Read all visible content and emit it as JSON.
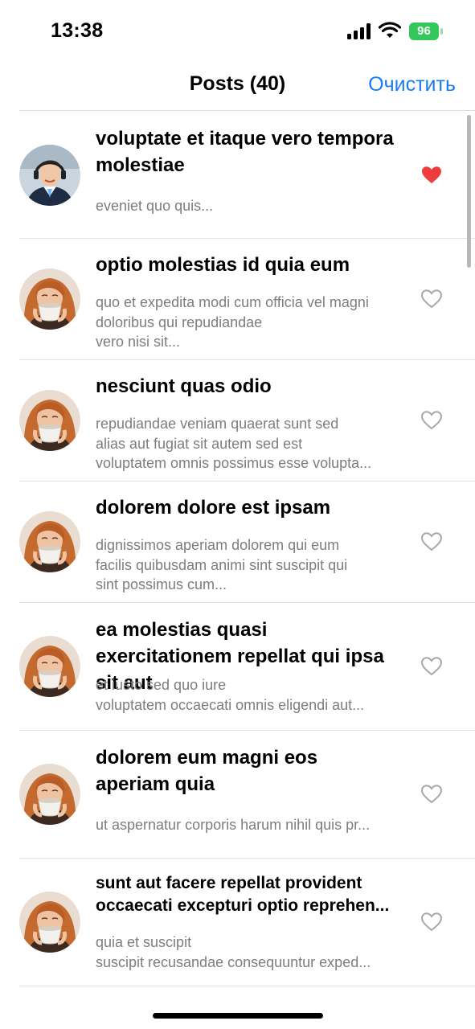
{
  "status_bar": {
    "time": "13:38",
    "battery": "96"
  },
  "nav": {
    "title": "Posts (40)",
    "action": "Очистить"
  },
  "posts": [
    {
      "title": "voluptate et itaque vero tempora molestiae",
      "body": [
        "eveniet quo quis..."
      ],
      "liked": true,
      "avatar": "man-headphones-icon"
    },
    {
      "title": "optio molestias id quia eum",
      "body": [
        "quo et expedita modi cum officia vel magni",
        "doloribus qui repudiandae",
        "vero nisi sit..."
      ],
      "liked": false,
      "avatar": "woman-coffee-icon"
    },
    {
      "title": "nesciunt quas odio",
      "body": [
        "repudiandae veniam quaerat sunt sed",
        "alias aut fugiat sit autem sed est",
        "voluptatem omnis possimus esse volupta..."
      ],
      "liked": false,
      "avatar": "woman-coffee-icon"
    },
    {
      "title": "dolorem dolore est ipsam",
      "body": [
        "dignissimos aperiam dolorem qui eum",
        "facilis quibusdam animi sint suscipit qui",
        "sint possimus cum..."
      ],
      "liked": false,
      "avatar": "woman-coffee-icon"
    },
    {
      "title": "ea molestias quasi exercitationem repellat qui ipsa sit aut",
      "body": [
        "et iusto sed quo iure",
        "voluptatem occaecati omnis eligendi aut..."
      ],
      "liked": false,
      "avatar": "woman-coffee-icon"
    },
    {
      "title": "dolorem eum magni eos aperiam quia",
      "body": [
        "ut aspernatur corporis harum nihil quis pr..."
      ],
      "liked": false,
      "avatar": "woman-coffee-icon"
    },
    {
      "title": "sunt aut facere repellat provident occaecati excepturi optio reprehen...",
      "body": [
        "quia et suscipit",
        "suscipit recusandae consequuntur exped..."
      ],
      "liked": false,
      "avatar": "woman-coffee-icon"
    }
  ],
  "colors": {
    "accent": "#1a7cf5",
    "heart_filled": "#ee3b3b",
    "heart_outline": "#a8a8a8",
    "battery": "#34c759"
  }
}
